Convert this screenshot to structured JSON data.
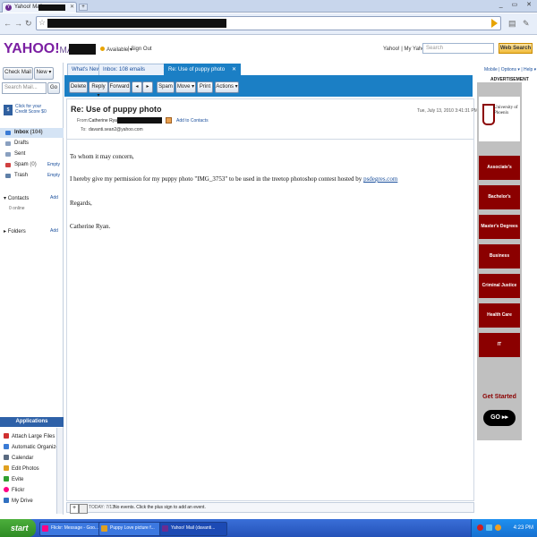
{
  "browser": {
    "tab_title": "Yahoo! Mail",
    "new_tab": "+",
    "window_controls": "_ ▭ ✕"
  },
  "header": {
    "logo_main": "YAHOO!",
    "logo_sub": "MAIL",
    "status": "Available ▾",
    "signout": "| Sign Out",
    "top_links": "Yahoo! | My Yahoo!",
    "search_placeholder": "Search",
    "web_search": "Web Search"
  },
  "left": {
    "check_mail": "Check Mail",
    "new": "New ▾",
    "search_placeholder": "Search Mail...",
    "go": "Go",
    "credit_line1": "Click for your",
    "credit_line2": "Credit Score $0",
    "folders": [
      {
        "label": "Inbox",
        "count": "(104)",
        "color": "#3a7bd5"
      },
      {
        "label": "Drafts",
        "count": "",
        "color": "#8aa0c0"
      },
      {
        "label": "Sent",
        "count": "",
        "color": "#8aa0c0"
      },
      {
        "label": "Spam",
        "count": "(0)",
        "color": "#d04040",
        "empty": "Empty"
      },
      {
        "label": "Trash",
        "count": "",
        "color": "#6080a8",
        "empty": "Empty"
      }
    ],
    "contacts": "Contacts",
    "contacts_add": "Add",
    "online": "0 online",
    "folders_label": "Folders",
    "folders_add": "Add",
    "applications": "Applications",
    "apps": [
      {
        "label": "Attach Large Files",
        "color": "#d03030"
      },
      {
        "label": "Automatic Organizer",
        "color": "#3a7bd5"
      },
      {
        "label": "Calendar",
        "color": "#5a6a80"
      },
      {
        "label": "Edit Photos",
        "color": "#e0a020"
      },
      {
        "label": "Evite",
        "color": "#30a030"
      },
      {
        "label": "Flickr",
        "color": "#ff0084"
      },
      {
        "label": "My Drive",
        "color": "#3070c0"
      }
    ]
  },
  "tabs": {
    "whats_new": "What's New",
    "inbox": "Inbox: 108 emails",
    "inbox_close": "✕",
    "message": "Re: Use of puppy photo",
    "message_close": "✕"
  },
  "toolbar": {
    "delete": "Delete",
    "reply": "Reply ▾",
    "forward": "Forward",
    "spam": "Spam",
    "move": "Move ▾",
    "print": "Print",
    "actions": "Actions ▾"
  },
  "message": {
    "subject": "Re: Use of puppy photo",
    "date": "Tue, July 13, 2010 3:41:31 PM",
    "from_label": "From:",
    "from_name": "Catherine Ryan",
    "add_to_contacts": "Add to Contacts",
    "to_label": "To:",
    "to_addr": "davanti.sean2@yahoo.com",
    "greeting": "To whom it may concern,",
    "body_text": "I hereby give my permission for my puppy photo \"IMG_3753\" to be used in the treetop photoshop contest hosted by",
    "body_link": "psdegres.com",
    "regards": "Regards,",
    "signature": "Catherine Ryan."
  },
  "events": {
    "today": "TODAY: 7/13",
    "text": "No events. Click the plus sign to add an event."
  },
  "ad": {
    "top_links": "Mobile | Options ▾ | Help ▾",
    "label": "ADVERTISEMENT",
    "logo": "University of Phoenix",
    "buttons": [
      "Associate's Degrees",
      "Bachelor's Degrees",
      "Master's Degrees",
      "Business",
      "Criminal Justice",
      "Health Care",
      "IT"
    ],
    "get_started": "Get Started",
    "go": "GO ▸▸"
  },
  "taskbar": {
    "start": "start",
    "tasks": [
      {
        "label": "Flickr: Message - Goo...",
        "color": "#ff0084"
      },
      {
        "label": "Puppy Love picture f...",
        "color": "#e0a020"
      },
      {
        "label": "Yahoo! Mail (davanti...",
        "color": "#6a2c91"
      }
    ],
    "clock": "4:23 PM"
  }
}
